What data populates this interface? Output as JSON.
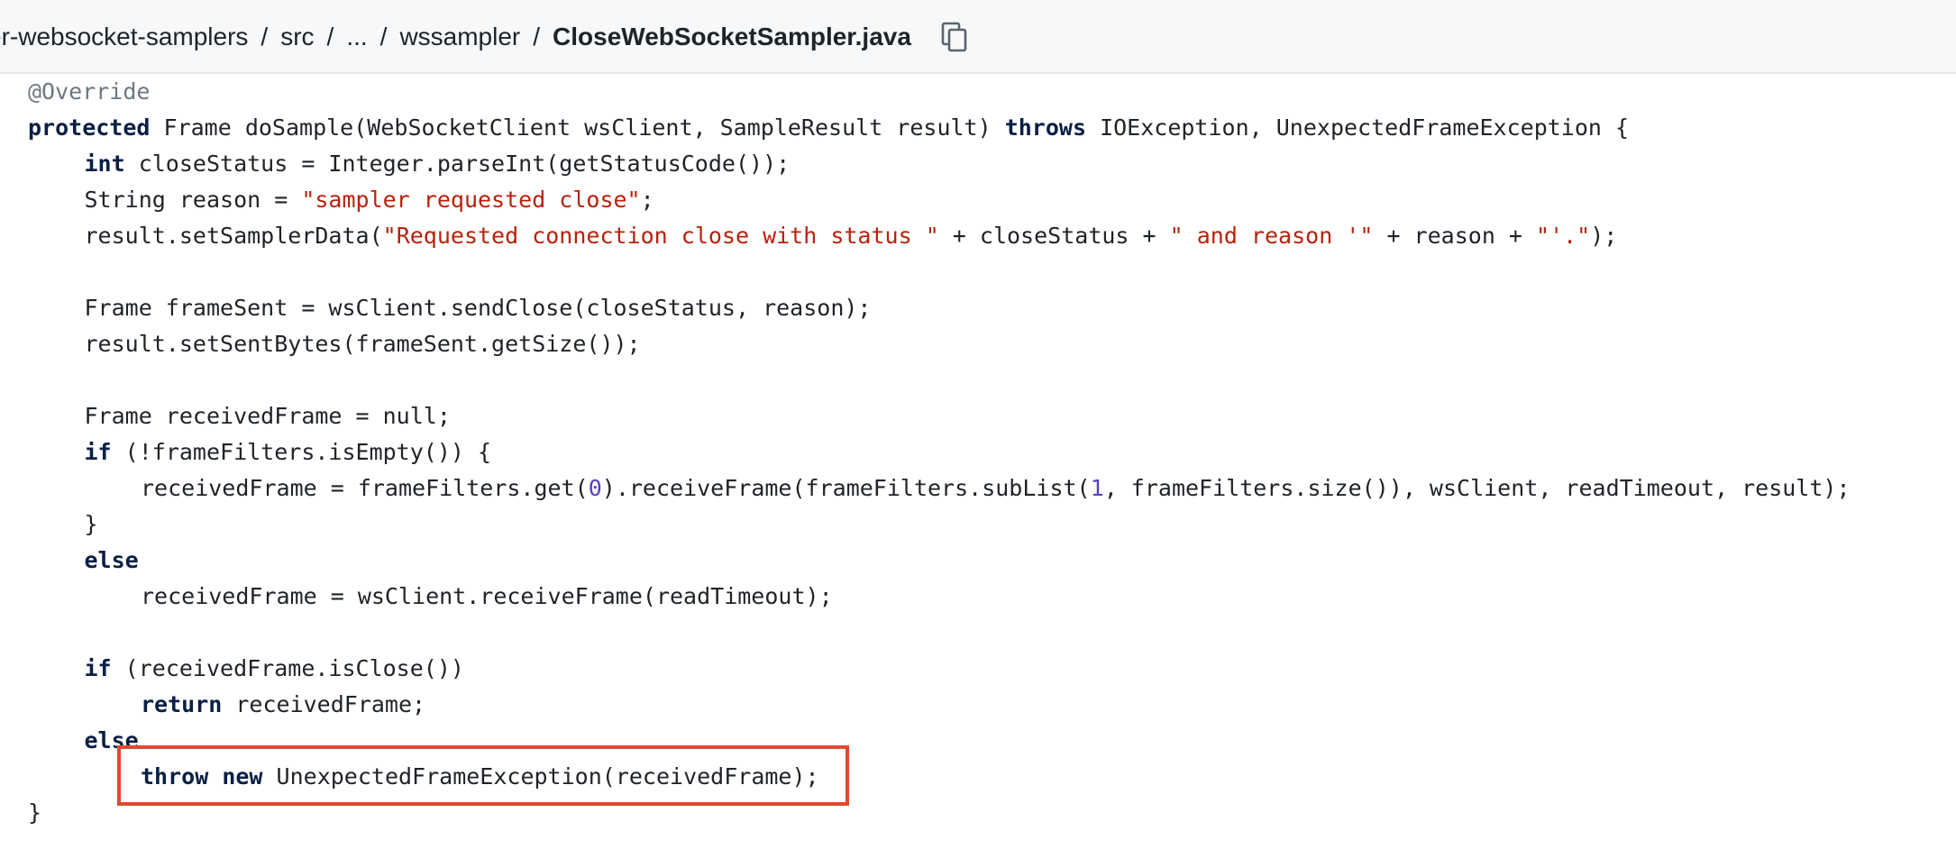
{
  "breadcrumb": {
    "repo_fragment": "er-websocket-samplers",
    "src": "src",
    "ellipsis": "...",
    "folder": "wssampler",
    "file": "CloseWebSocketSampler.java",
    "separator": "/"
  },
  "copy_icon": "copy-icon",
  "code": {
    "l1": {
      "annotation": "@Override"
    },
    "l2": {
      "kw_protected": "protected",
      "sig": " Frame doSample(WebSocketClient wsClient, SampleResult result) ",
      "kw_throws": "throws",
      "rest": " IOException, UnexpectedFrameException {"
    },
    "l3": {
      "kw_int": "int",
      "rest": " closeStatus = Integer.parseInt(getStatusCode());"
    },
    "l4": {
      "prefix": "String reason = ",
      "str": "\"sampler requested close\"",
      "suffix": ";"
    },
    "l5": {
      "p1": "result.setSamplerData(",
      "s1": "\"Requested connection close with status \"",
      "p2": " + closeStatus + ",
      "s2": "\" and reason '\"",
      "p3": " + reason + ",
      "s3": "\"'.\"",
      "p4": ");"
    },
    "l7": {
      "text": "Frame frameSent = wsClient.sendClose(closeStatus, reason);"
    },
    "l8": {
      "text": "result.setSentBytes(frameSent.getSize());"
    },
    "l10": {
      "text": "Frame receivedFrame = null;"
    },
    "l11": {
      "kw_if": "if",
      "rest": " (!frameFilters.isEmpty()) {"
    },
    "l12": {
      "p1": "receivedFrame = frameFilters.get(",
      "n1": "0",
      "p2": ").receiveFrame(frameFilters.subList(",
      "n2": "1",
      "p3": ", frameFilters.size()), wsClient, readTimeout, result);"
    },
    "l13": {
      "text": "}"
    },
    "l14": {
      "kw_else": "else"
    },
    "l15": {
      "text": "receivedFrame = wsClient.receiveFrame(readTimeout);"
    },
    "l17": {
      "kw_if": "if",
      "rest": " (receivedFrame.isClose())"
    },
    "l18": {
      "kw_return": "return",
      "rest": " receivedFrame;"
    },
    "l19": {
      "kw_else": "else"
    },
    "l20": {
      "kw_throw": "throw",
      "kw_new": "new",
      "rest": " UnexpectedFrameException(receivedFrame);"
    },
    "l21": {
      "text": "}"
    }
  },
  "colors": {
    "keyword": "#0a1f44",
    "string": "#b7220b",
    "number": "#5a3fc0",
    "annotation": "#6e7781",
    "highlight_border": "#e04a2f"
  }
}
